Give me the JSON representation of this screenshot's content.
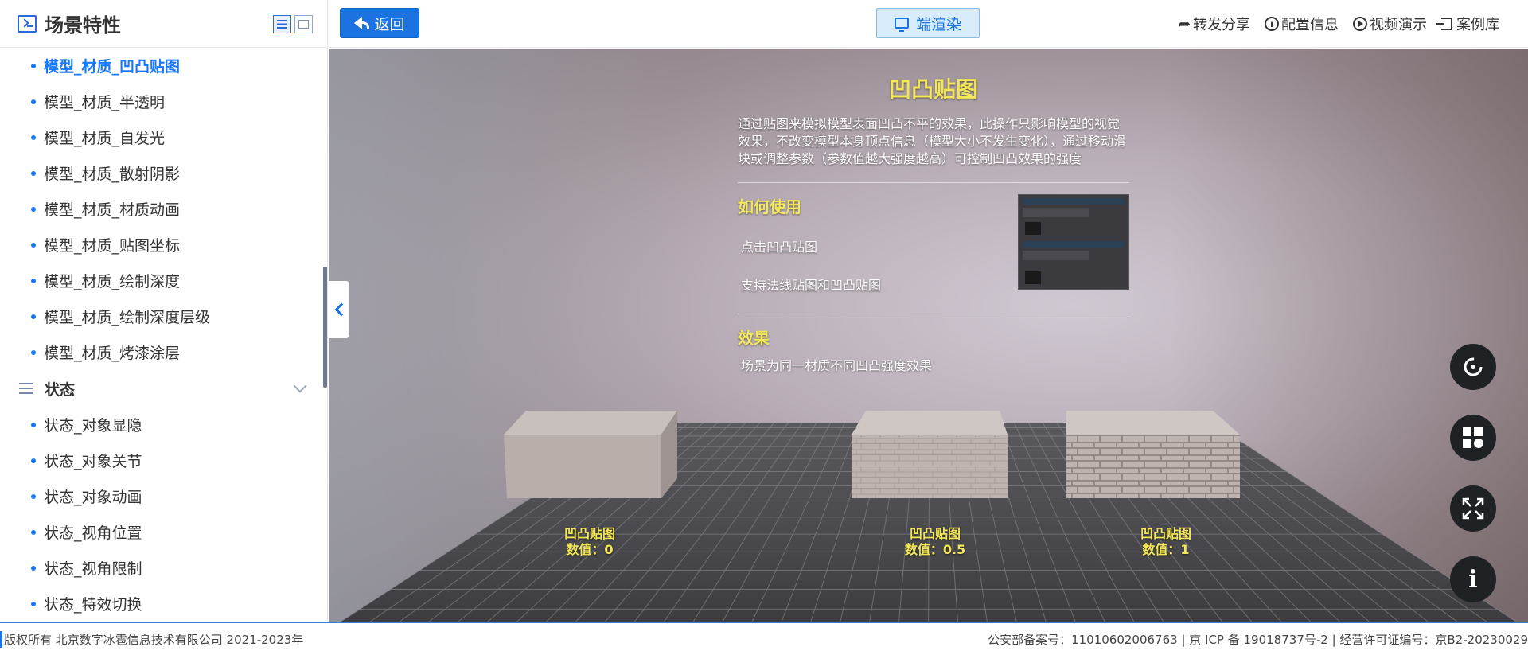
{
  "sidebar": {
    "title": "场景特性",
    "items_top": [
      {
        "label": "模型_材质_凹凸贴图",
        "active": true
      },
      {
        "label": "模型_材质_半透明"
      },
      {
        "label": "模型_材质_自发光"
      },
      {
        "label": "模型_材质_散射阴影"
      },
      {
        "label": "模型_材质_材质动画"
      },
      {
        "label": "模型_材质_贴图坐标"
      },
      {
        "label": "模型_材质_绘制深度"
      },
      {
        "label": "模型_材质_绘制深度层级"
      },
      {
        "label": "模型_材质_烤漆涂层"
      }
    ],
    "group_label": "状态",
    "items_state": [
      {
        "label": "状态_对象显隐"
      },
      {
        "label": "状态_对象关节"
      },
      {
        "label": "状态_对象动画"
      },
      {
        "label": "状态_视角位置"
      },
      {
        "label": "状态_视角限制"
      },
      {
        "label": "状态_特效切换"
      }
    ]
  },
  "topbar": {
    "back_label": "返回",
    "render_label": "端渲染",
    "actions": [
      "转发分享",
      "配置信息",
      "视频演示",
      "案例库"
    ]
  },
  "panel": {
    "title": "凹凸贴图",
    "desc": "通过贴图来模拟模型表面凹凸不平的效果，此操作只影响模型的视觉效果，不改变模型本身顶点信息（模型大小不发生变化），通过移动滑块或调整参数（参数值越大强度越高）可控制凹凸效果的强度",
    "howto_title": "如何使用",
    "howto_1": "点击凹凸贴图",
    "howto_2": "支持法线贴图和凹凸贴图",
    "effect_title": "效果",
    "effect_text": "场景为同一材质不同凹凸强度效果"
  },
  "boxes": [
    {
      "name": "凹凸贴图",
      "value": "数值：0"
    },
    {
      "name": "凹凸贴图",
      "value": "数值：0.5"
    },
    {
      "name": "凹凸贴图",
      "value": "数值：1"
    }
  ],
  "footer": {
    "left": "版权所有 北京数字冰雹信息技术有限公司 2021-2023年",
    "right": "公安部备案号：11010602006763 | 京 ICP 备 19018737号-2 | 经营许可证编号：京B2-20230029"
  },
  "colors": {
    "accent": "#1a73e0",
    "highlight": "#f4e85a"
  }
}
